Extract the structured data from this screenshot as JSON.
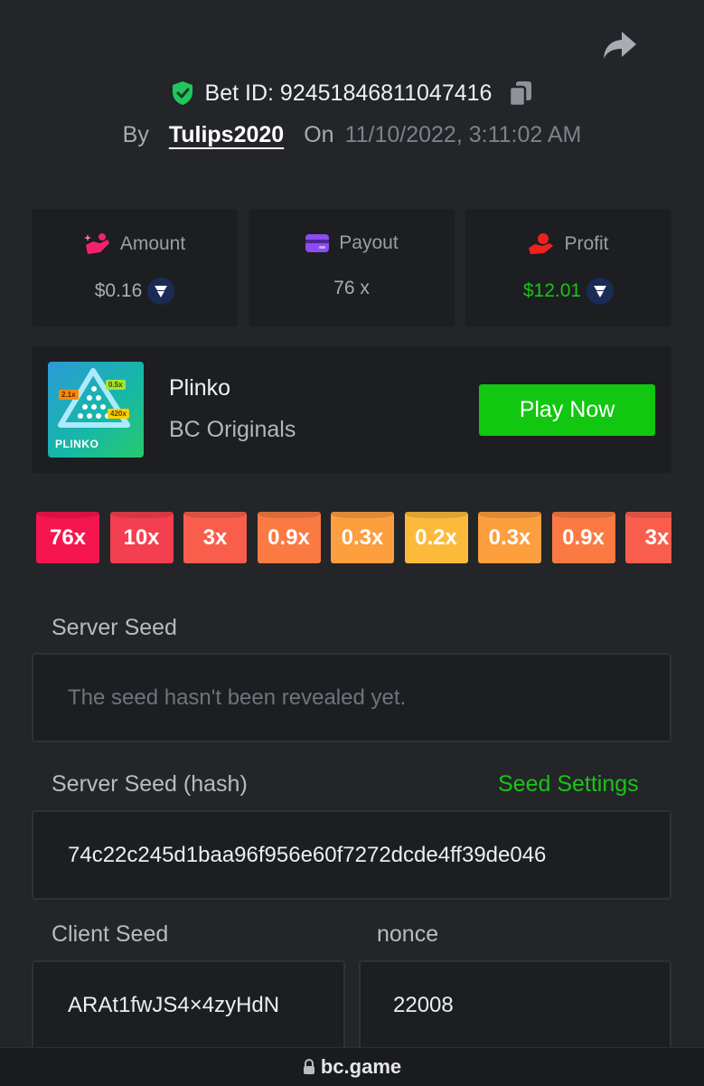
{
  "header": {
    "bet_id_label": "Bet ID:",
    "bet_id": "92451846811047416",
    "by_label": "By",
    "username": "Tulips2020",
    "on_label": "On",
    "datetime": "11/10/2022, 3:11:02 AM"
  },
  "stats": {
    "amount": {
      "label": "Amount",
      "value": "$0.16",
      "icon": "hand-coins-icon"
    },
    "payout": {
      "label": "Payout",
      "value": "76 x",
      "icon": "wallet-card-icon"
    },
    "profit": {
      "label": "Profit",
      "value": "$12.01",
      "icon": "profit-hand-icon"
    }
  },
  "game": {
    "thumb_logo": "PLINKO",
    "thumb_tags": [
      "2.1x",
      "0.5x",
      "420x"
    ],
    "name": "Plinko",
    "provider": "BC Originals",
    "play_label": "Play Now"
  },
  "multipliers": [
    {
      "label": "76x",
      "color": "#f5164f"
    },
    {
      "label": "10x",
      "color": "#f33f4f"
    },
    {
      "label": "3x",
      "color": "#f95e4c"
    },
    {
      "label": "0.9x",
      "color": "#fb7a44"
    },
    {
      "label": "0.3x",
      "color": "#fd9e3f"
    },
    {
      "label": "0.2x",
      "color": "#fcba3b"
    },
    {
      "label": "0.3x",
      "color": "#fd9e3f"
    },
    {
      "label": "0.9x",
      "color": "#fb7a44"
    },
    {
      "label": "3x",
      "color": "#f95e4c"
    }
  ],
  "fairness": {
    "server_seed_label": "Server Seed",
    "server_seed_value": "The seed hasn't been revealed yet.",
    "server_hash_label": "Server Seed (hash)",
    "seed_settings_label": "Seed Settings",
    "server_hash_value": "74c22c245d1baa96f956e60f7272dcde4ff39de046",
    "client_seed_label": "Client Seed",
    "client_seed_value": "ARAt1fwJS4×4zyHdN",
    "nonce_label": "nonce",
    "nonce_value": "22008"
  },
  "browser": {
    "url": "bc.game"
  },
  "colors": {
    "accent_green": "#12c70f",
    "verified_shield": "#22c55e",
    "profit_green": "#19c415"
  }
}
